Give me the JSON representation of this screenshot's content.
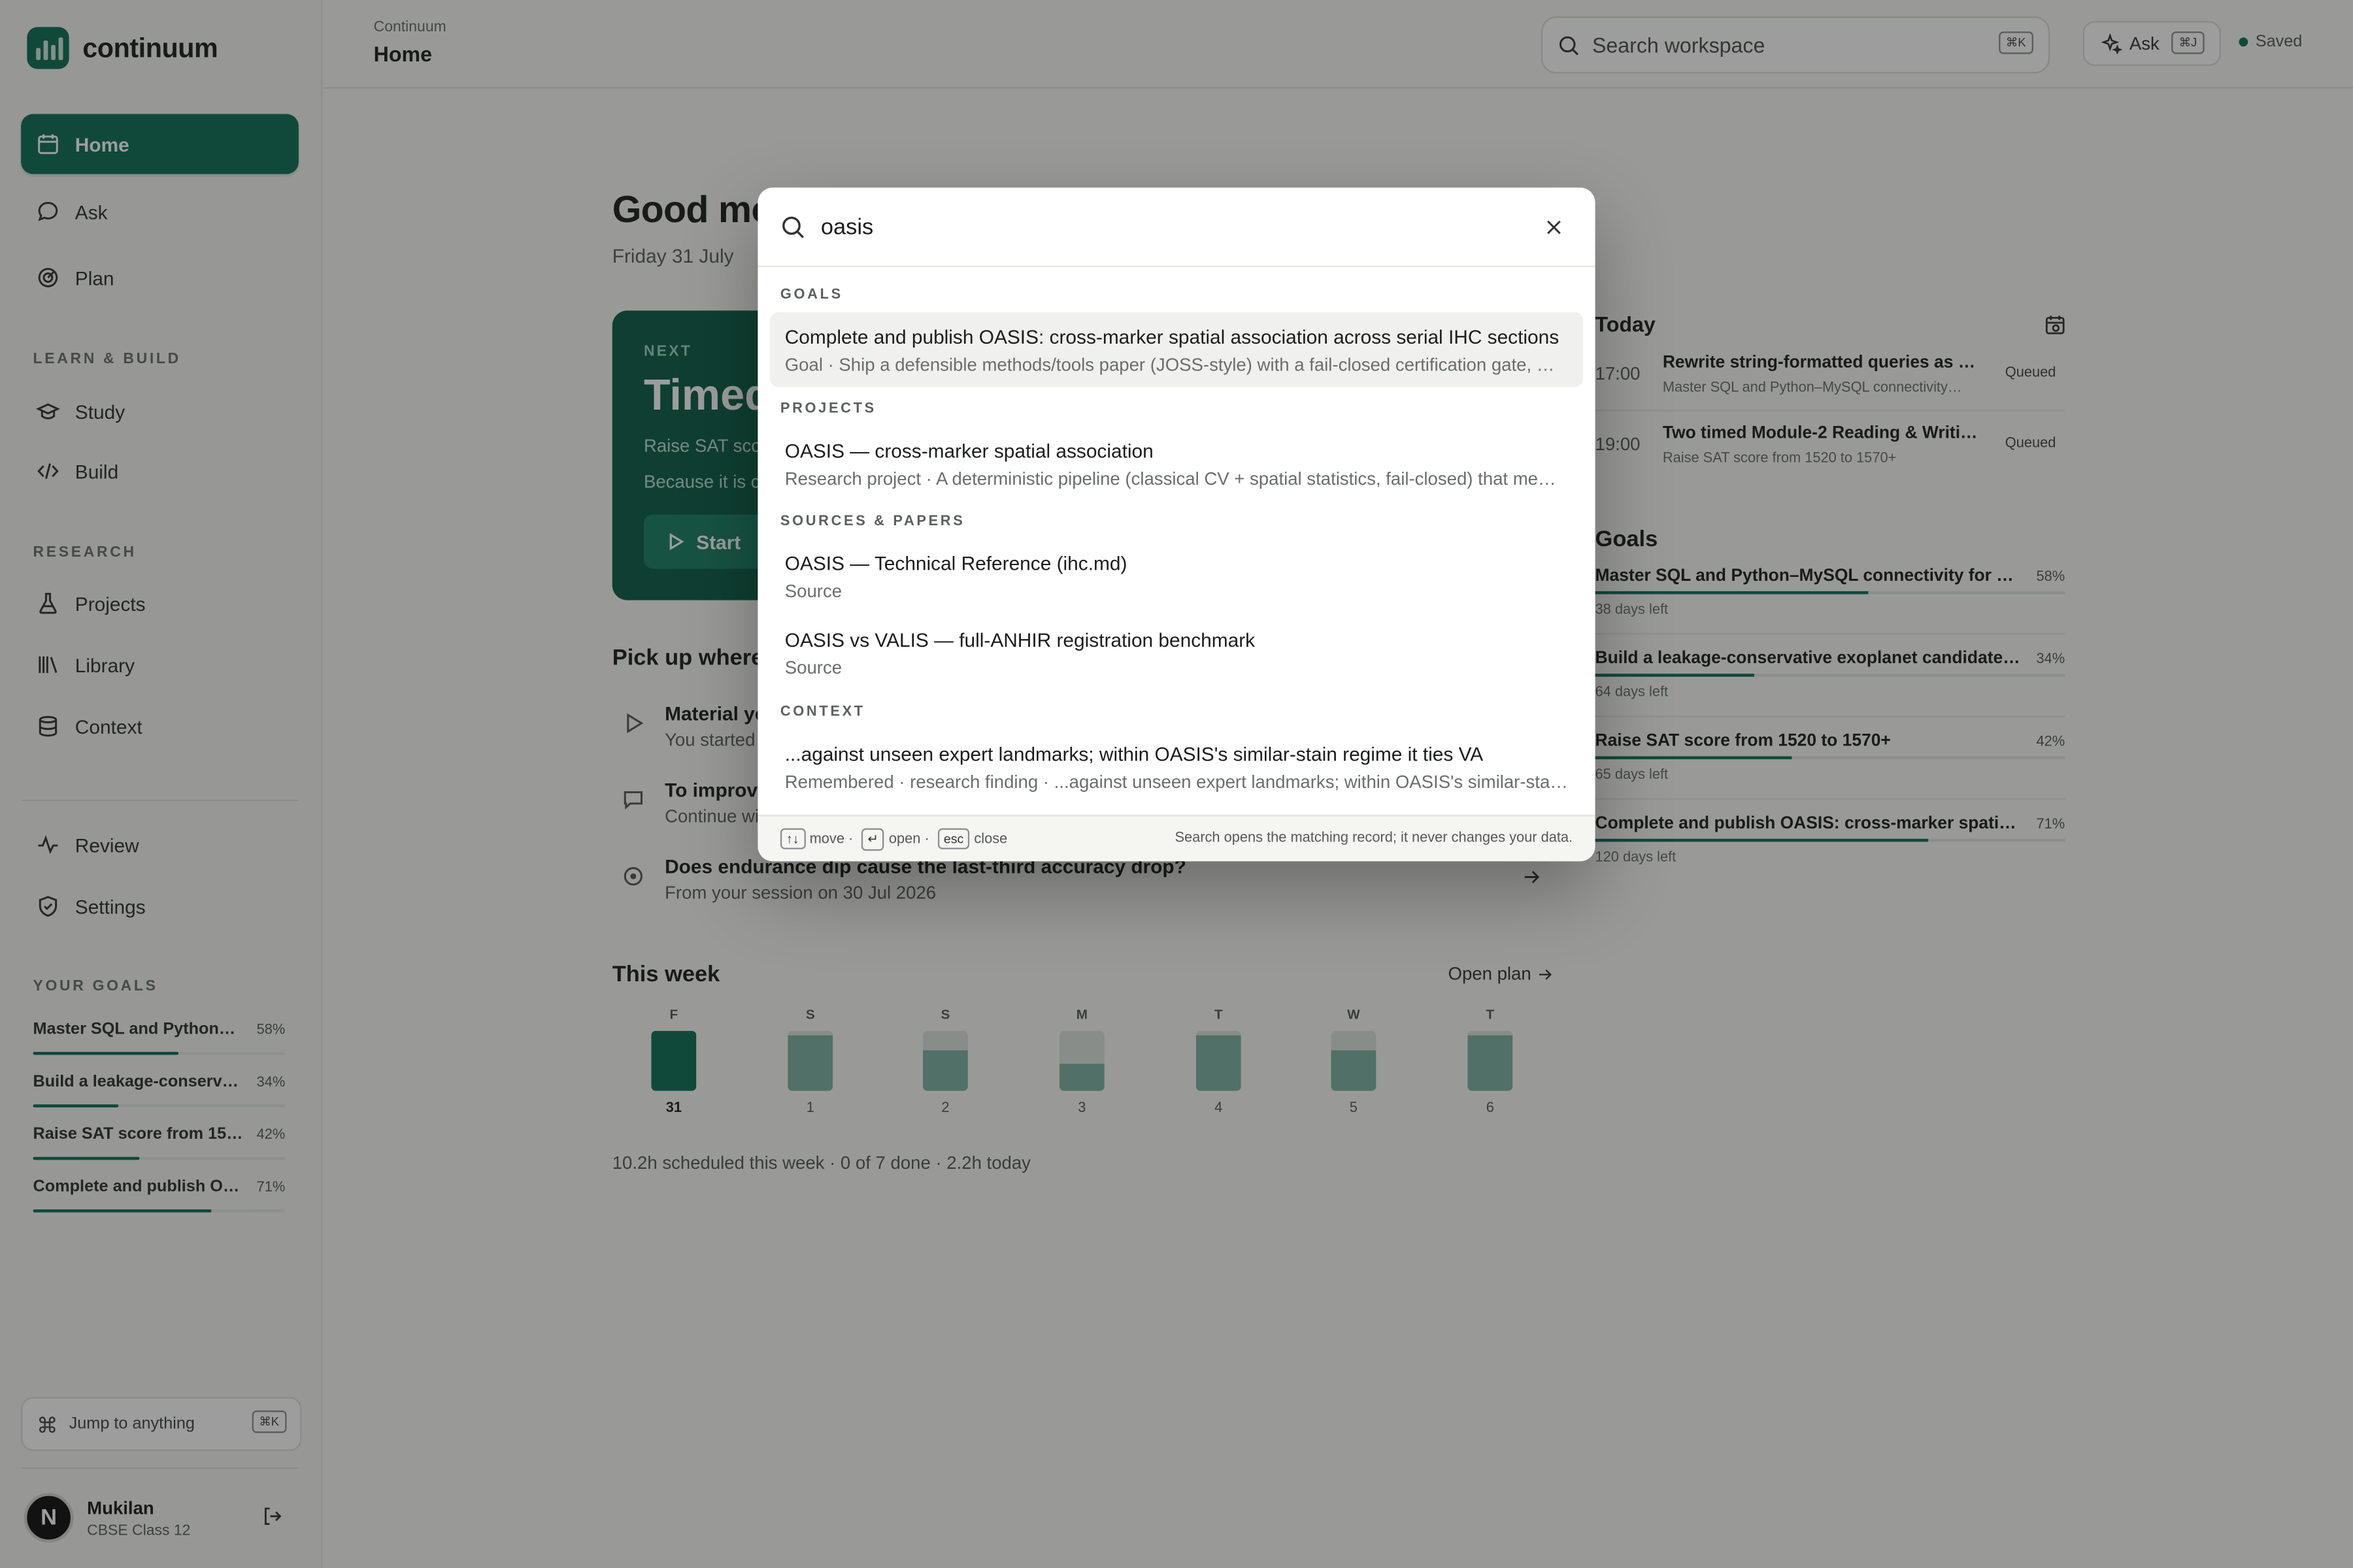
{
  "app": {
    "name": "continuum"
  },
  "sidebar": {
    "nav_main": [
      {
        "label": "Home",
        "icon": "calendar-icon",
        "active": true
      },
      {
        "label": "Ask",
        "icon": "chat-bubble-icon"
      },
      {
        "label": "Plan",
        "icon": "target-icon"
      }
    ],
    "section_learn": "LEARN & BUILD",
    "nav_learn": [
      {
        "label": "Study",
        "icon": "graduation-cap-icon"
      },
      {
        "label": "Build",
        "icon": "code-icon"
      }
    ],
    "section_research": "RESEARCH",
    "nav_research": [
      {
        "label": "Projects",
        "icon": "flask-icon"
      },
      {
        "label": "Library",
        "icon": "books-icon"
      },
      {
        "label": "Context",
        "icon": "database-icon"
      }
    ],
    "nav_bottom": [
      {
        "label": "Review",
        "icon": "activity-icon"
      },
      {
        "label": "Settings",
        "icon": "shield-icon"
      }
    ],
    "section_goals": "YOUR GOALS",
    "goals": [
      {
        "title": "Master SQL and Python…",
        "pct": "58%",
        "progress": 0.58
      },
      {
        "title": "Build a leakage-conserv…",
        "pct": "34%",
        "progress": 0.34
      },
      {
        "title": "Raise SAT score from 15…",
        "pct": "42%",
        "progress": 0.42
      },
      {
        "title": "Complete and publish O…",
        "pct": "71%",
        "progress": 0.71
      }
    ],
    "jump": {
      "label": "Jump to anything",
      "shortcut": "⌘K"
    },
    "user": {
      "initial": "N",
      "name": "Mukilan",
      "subtitle": "CBSE Class 12"
    }
  },
  "topbar": {
    "breadcrumb": "Continuum",
    "title": "Home",
    "search_placeholder": "Search workspace",
    "search_shortcut": "⌘K",
    "ask_label": "Ask",
    "ask_shortcut": "⌘J",
    "status": "Saved"
  },
  "main": {
    "greeting": "Good mo",
    "date": "Friday 31 July",
    "next": {
      "label": "NEXT",
      "title": "Timed",
      "line1": "Raise SAT sco",
      "line2": "Because it is c",
      "button": "Start"
    },
    "pickup": {
      "heading": "Pick up where",
      "items": [
        {
          "title": "Material yo",
          "sub": "You started",
          "icon": "play-icon"
        },
        {
          "title": "To improve",
          "sub": "Continue wi",
          "icon": "chat-bubble-icon"
        },
        {
          "title": "Does endurance dip cause the last-third accuracy drop?",
          "sub": "From your session on 30 Jul 2026",
          "icon": "target-icon"
        }
      ]
    },
    "week": {
      "heading": "This week",
      "open_plan": "Open plan",
      "days": [
        {
          "letter": "F",
          "num": "31",
          "fill": 1.0,
          "today": true
        },
        {
          "letter": "S",
          "num": "1",
          "fill": 0.92
        },
        {
          "letter": "S",
          "num": "2",
          "fill": 0.68
        },
        {
          "letter": "M",
          "num": "3",
          "fill": 0.45
        },
        {
          "letter": "T",
          "num": "4",
          "fill": 0.92
        },
        {
          "letter": "W",
          "num": "5",
          "fill": 0.68
        },
        {
          "letter": "T",
          "num": "6",
          "fill": 0.92
        }
      ],
      "summary": "10.2h scheduled this week · 0 of 7 done · 2.2h today"
    }
  },
  "today": {
    "heading": "Today",
    "items": [
      {
        "time": "17:00",
        "title": "Rewrite string-formatted queries as …",
        "sub": "Master SQL and Python–MySQL connectivity…",
        "status": "Queued"
      },
      {
        "time": "19:00",
        "title": "Two timed Module-2 Reading & Writi…",
        "sub": "Raise SAT score from 1520 to 1570+",
        "status": "Queued"
      }
    ]
  },
  "goals_panel": {
    "heading": "Goals",
    "items": [
      {
        "title": "Master SQL and Python–MySQL connectivity for C…",
        "pct": "58%",
        "progress": 0.58,
        "days": "38 days left"
      },
      {
        "title": "Build a leakage-conservative exoplanet candidate …",
        "pct": "34%",
        "progress": 0.34,
        "days": "64 days left"
      },
      {
        "title": "Raise SAT score from 1520 to 1570+",
        "pct": "42%",
        "progress": 0.42,
        "days": "65 days left"
      },
      {
        "title": "Complete and publish OASIS: cross-marker spatial…",
        "pct": "71%",
        "progress": 0.71,
        "days": "120 days left"
      }
    ]
  },
  "search_modal": {
    "query": "oasis",
    "groups": [
      {
        "label": "GOALS",
        "results": [
          {
            "title": "Complete and publish OASIS: cross-marker spatial association across serial IHC sections",
            "sub": "Goal · Ship a defensible methods/tools paper (JOSS-style) with a fail-closed certification gate, …",
            "selected": true
          }
        ]
      },
      {
        "label": "PROJECTS",
        "results": [
          {
            "title": "OASIS — cross-marker spatial association",
            "sub": "Research project · A deterministic pipeline (classical CV + spatial statistics, fail-closed) that me…"
          }
        ]
      },
      {
        "label": "SOURCES & PAPERS",
        "results": [
          {
            "title": "OASIS — Technical Reference (ihc.md)",
            "sub": "Source"
          },
          {
            "title": "OASIS vs VALIS — full-ANHIR registration benchmark",
            "sub": "Source"
          }
        ]
      },
      {
        "label": "CONTEXT",
        "results": [
          {
            "title": "...against unseen expert landmarks; within OASIS's similar-stain regime it ties VA",
            "sub": "Remembered · research finding · ...against unseen expert landmarks; within OASIS's similar-stai…"
          }
        ]
      }
    ],
    "footer": {
      "move_key": "↑↓",
      "move_label": "move ·",
      "open_key": "↵",
      "open_label": "open ·",
      "close_key": "esc",
      "close_label": "close",
      "note": "Search opens the matching record; it never changes your data."
    }
  },
  "colors": {
    "brand": "#0f6e56",
    "overlay": "rgba(20,22,20,0.42)"
  }
}
